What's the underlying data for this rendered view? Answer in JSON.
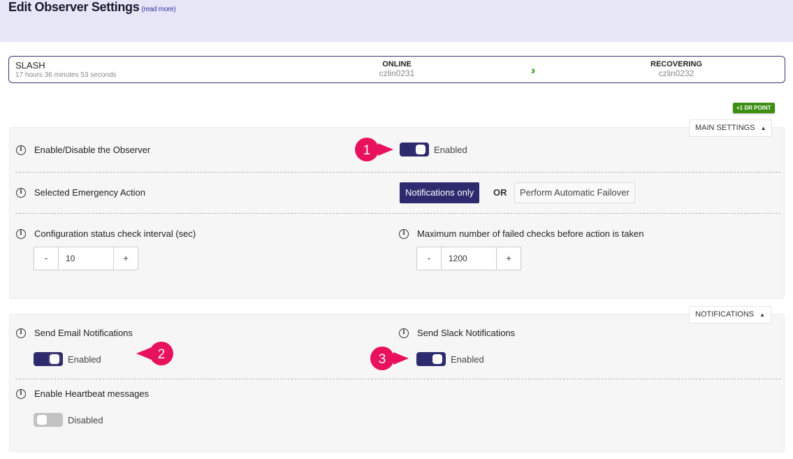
{
  "header": {
    "title": "Edit Observer Settings",
    "read_more": "(read more)",
    "background": "#e6e6f7"
  },
  "status": {
    "name": "SLASH",
    "uptime": "17 hours 36 minutes 53 seconds",
    "primary": {
      "label": "ONLINE",
      "host": "czlin0231"
    },
    "secondary": {
      "label": "RECOVERING",
      "host": "czlin0232"
    },
    "arrow_icon": "double-chevron-right-icon"
  },
  "dr_badge": "+1 DR POINT",
  "main_settings": {
    "tag": "MAIN SETTINGS",
    "observer": {
      "label": "Enable/Disable the Observer",
      "state": "Enabled"
    },
    "emergency": {
      "label": "Selected Emergency Action",
      "selected": "Notifications only",
      "or": "OR",
      "alternative": "Perform Automatic Failover"
    },
    "check_interval": {
      "label": "Configuration status check interval (sec)",
      "minus": "-",
      "value": "10",
      "plus": "+"
    },
    "max_failed": {
      "label": "Maximum number of failed checks before action is taken",
      "minus": "-",
      "value": "1200",
      "plus": "+"
    }
  },
  "notifications": {
    "tag": "NOTIFICATIONS",
    "email": {
      "label": "Send Email Notifications",
      "state": "Enabled"
    },
    "slack": {
      "label": "Send Slack Notifications",
      "state": "Enabled"
    },
    "heartbeat": {
      "label": "Enable Heartbeat messages",
      "state": "Disabled"
    }
  },
  "callouts": [
    "1",
    "2",
    "3"
  ],
  "colors": {
    "accent": "#2e2a6e",
    "callout": "#e8115b",
    "success": "#3d8f13"
  }
}
